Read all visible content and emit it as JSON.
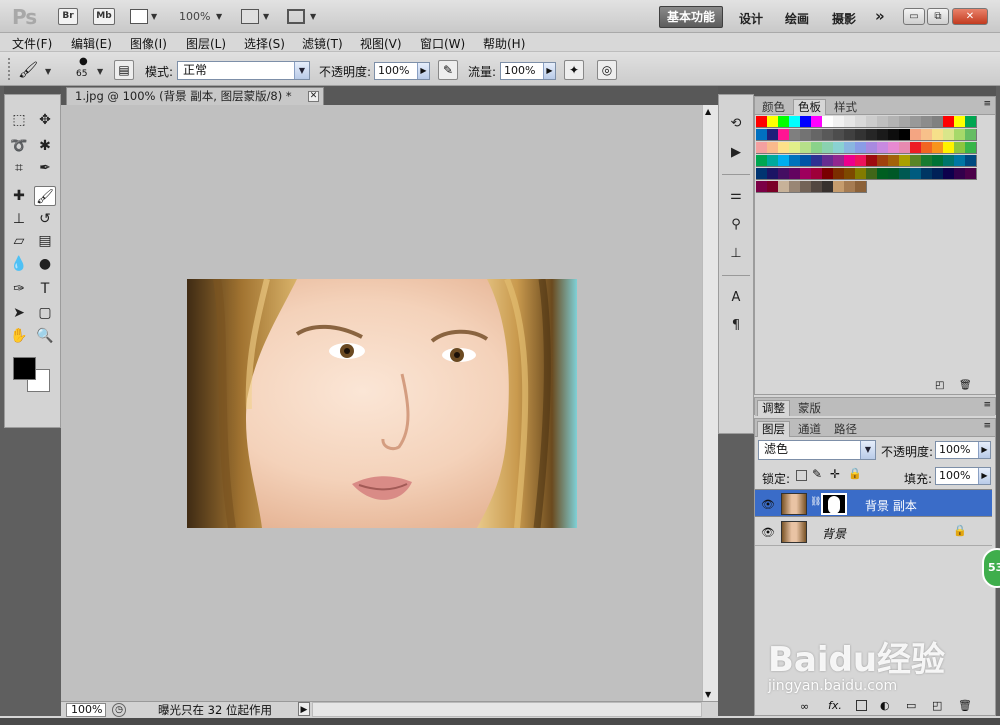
{
  "app": {
    "logo": "Ps",
    "bridge_label": "Br",
    "mini_bridge_label": "Mb",
    "zoom": "100%"
  },
  "workspaces": {
    "active": "基本功能",
    "items": [
      "设计",
      "绘画",
      "摄影"
    ],
    "more": "»"
  },
  "window_controls": {
    "minimize": "▭",
    "restore": "⧉",
    "close": "✕"
  },
  "menu": [
    "文件(F)",
    "编辑(E)",
    "图像(I)",
    "图层(L)",
    "选择(S)",
    "滤镜(T)",
    "视图(V)",
    "窗口(W)",
    "帮助(H)"
  ],
  "options": {
    "brush_size": "65",
    "mode_label": "模式:",
    "mode_value": "正常",
    "opacity_label": "不透明度:",
    "opacity_value": "100%",
    "flow_label": "流量:",
    "flow_value": "100%"
  },
  "document": {
    "tab_title": "1.jpg @ 100% (背景 副本, 图层蒙版/8) *",
    "zoom": "100%",
    "status_text": "曝光只在 32 位起作用"
  },
  "tools": {
    "icons": [
      "marquee-icon",
      "move-icon",
      "lasso-icon",
      "magic-wand-icon",
      "crop-icon",
      "eyedropper-icon",
      "healing-brush-icon",
      "brush-icon",
      "clone-stamp-icon",
      "history-brush-icon",
      "eraser-icon",
      "gradient-icon",
      "blur-icon",
      "dodge-icon",
      "pen-icon",
      "type-icon",
      "path-select-icon",
      "shape-icon",
      "hand-icon",
      "zoom-icon"
    ],
    "foreground": "#000000",
    "background": "#ffffff"
  },
  "swatches_panel": {
    "tabs": [
      "颜色",
      "色板",
      "样式"
    ],
    "active_tab": "色板"
  },
  "adjust_panel": {
    "tabs": [
      "调整",
      "蒙版"
    ],
    "active_tab": "调整"
  },
  "layers_panel": {
    "tabs": [
      "图层",
      "通道",
      "路径"
    ],
    "active_tab": "图层",
    "blend_mode": "滤色",
    "opacity_label": "不透明度:",
    "opacity_value": "100%",
    "lock_label": "锁定:",
    "fill_label": "填充:",
    "fill_value": "100%",
    "layers": [
      {
        "name": "背景 副本",
        "selected": true
      },
      {
        "name": "背景",
        "selected": false,
        "locked": true
      }
    ],
    "bottom_icons": [
      "link-icon",
      "fx-icon",
      "mask-icon",
      "adjustment-icon",
      "group-icon",
      "new-layer-icon",
      "trash-icon"
    ]
  },
  "badge": "53",
  "watermark": {
    "line1": "Baidu经验",
    "line2": "jingyan.baidu.com"
  },
  "colors": {
    "selection_blue": "#3a6cc8",
    "canvas_gray": "#c0c0c0",
    "panel_gray": "#d6d6d6"
  }
}
